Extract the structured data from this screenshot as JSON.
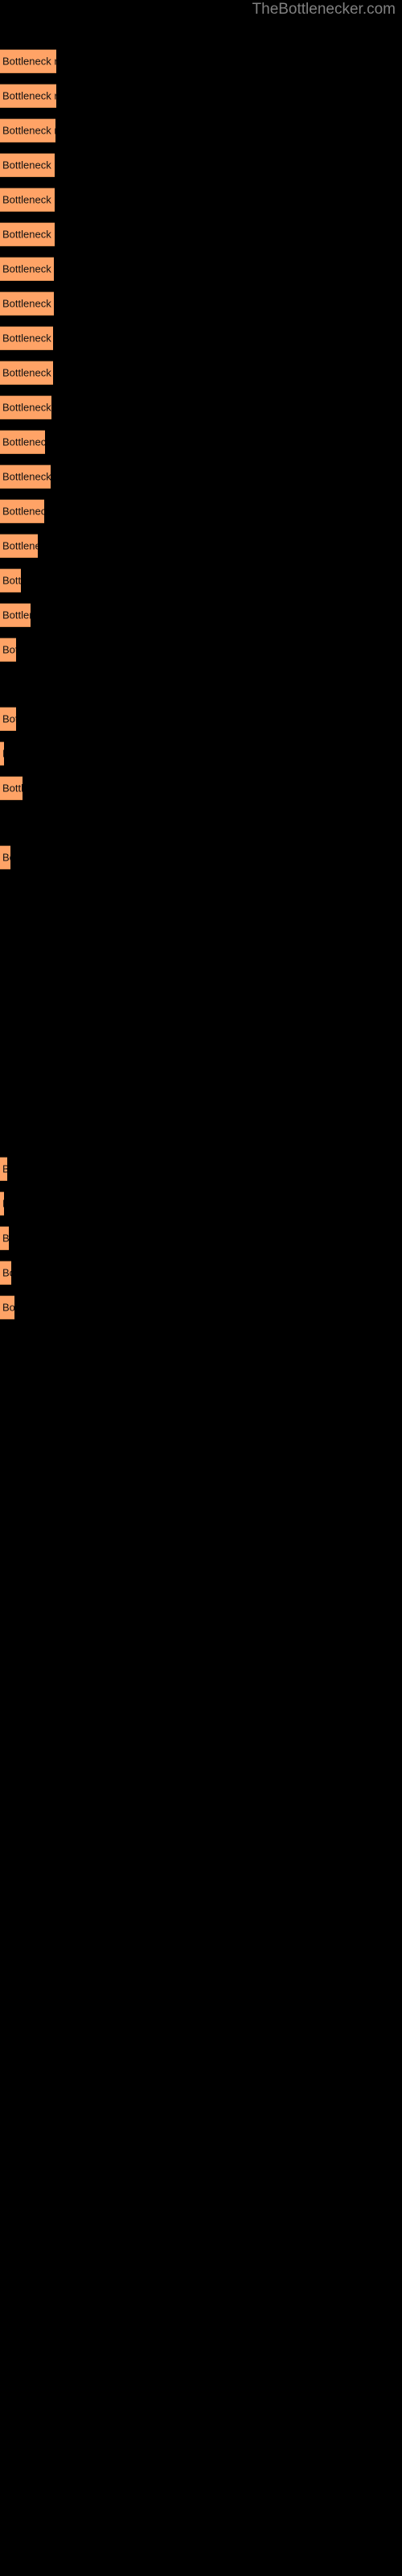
{
  "site": {
    "watermark": "TheBottlenecker.com"
  },
  "colors": {
    "background": "#000000",
    "bar_fill": "#ffa366",
    "bar_border_top": "#5a3b22",
    "bar_text": "#111111",
    "watermark_text": "#808080"
  },
  "chart_data": {
    "type": "bar",
    "orientation": "horizontal",
    "title": "",
    "subtitle": "",
    "xlabel": "",
    "ylabel": "",
    "grid": false,
    "legend": null,
    "axis_labels_visible": false,
    "bar_label_template": "Bottleneck result",
    "xlim": [
      0,
      500
    ],
    "categories": [
      "Bottleneck result",
      "Bottleneck result",
      "Bottleneck result",
      "Bottleneck result",
      "Bottleneck result",
      "Bottleneck result",
      "Bottleneck result",
      "Bottleneck result",
      "Bottleneck result",
      "Bottleneck result",
      "Bottleneck result",
      "Bottleneck result",
      "Bottleneck result",
      "Bottleneck result",
      "Bottleneck result",
      "Bottleneck result",
      "Bottleneck result",
      "Bottleneck result",
      "Bottleneck result",
      "Bottleneck result",
      "Bottleneck result",
      "Bottleneck result",
      "Bottleneck result",
      "Bottleneck result",
      "Bottleneck result",
      "Bottleneck result",
      "Bottleneck result",
      "Bottleneck result",
      "Bottleneck result",
      "Bottleneck result",
      "Bottleneck result"
    ],
    "values": [
      70,
      70,
      69,
      68,
      68,
      68,
      67,
      67,
      66,
      66,
      64,
      56,
      63,
      55,
      47,
      38,
      44,
      20,
      38,
      22,
      11,
      32,
      13,
      9,
      5,
      5,
      9,
      4,
      14,
      16,
      18
    ],
    "bars": [
      {
        "index": 1,
        "label": "Bottleneck result",
        "top": 61,
        "width": 70,
        "height": 30
      },
      {
        "index": 2,
        "label": "Bottleneck result",
        "top": 104,
        "width": 70,
        "height": 30
      },
      {
        "index": 3,
        "label": "Bottleneck result",
        "top": 147,
        "width": 69,
        "height": 30
      },
      {
        "index": 4,
        "label": "Bottleneck resu",
        "top": 190,
        "width": 68,
        "height": 30
      },
      {
        "index": 5,
        "label": "Bottleneck resu",
        "top": 233,
        "width": 68,
        "height": 30
      },
      {
        "index": 6,
        "label": "Bottleneck resu",
        "top": 276,
        "width": 68,
        "height": 30
      },
      {
        "index": 7,
        "label": "Bottleneck resu",
        "top": 319,
        "width": 67,
        "height": 30
      },
      {
        "index": 8,
        "label": "Bottleneck resu",
        "top": 362,
        "width": 67,
        "height": 30
      },
      {
        "index": 9,
        "label": "Bottleneck resu",
        "top": 405,
        "width": 66,
        "height": 30
      },
      {
        "index": 10,
        "label": "Bottleneck resu",
        "top": 448,
        "width": 66,
        "height": 30
      },
      {
        "index": 11,
        "label": "Bottleneck res",
        "top": 491,
        "width": 64,
        "height": 30
      },
      {
        "index": 12,
        "label": "Bottleneck re",
        "top": 534,
        "width": 56,
        "height": 30
      },
      {
        "index": 13,
        "label": "Bottleneck res",
        "top": 577,
        "width": 63,
        "height": 30
      },
      {
        "index": 14,
        "label": "Bottleneck re",
        "top": 620,
        "width": 55,
        "height": 30
      },
      {
        "index": 15,
        "label": "Bottleneck",
        "top": 663,
        "width": 47,
        "height": 30
      },
      {
        "index": 16,
        "label": "Bot",
        "top": 706,
        "width": 26,
        "height": 30
      },
      {
        "index": 17,
        "label": "Bottlen",
        "top": 749,
        "width": 38,
        "height": 30
      },
      {
        "index": 18,
        "label": "Bo",
        "top": 792,
        "width": 20,
        "height": 30
      },
      {
        "index": 19,
        "label": "Bo",
        "top": 878,
        "width": 20,
        "height": 30
      },
      {
        "index": 20,
        "label": "",
        "top": 921,
        "width": 5,
        "height": 30
      },
      {
        "index": 21,
        "label": "Bott",
        "top": 964,
        "width": 28,
        "height": 30
      },
      {
        "index": 22,
        "label": "B",
        "top": 1050,
        "width": 13,
        "height": 30
      },
      {
        "index": 23,
        "label": "B",
        "top": 1437,
        "width": 9,
        "height": 30
      },
      {
        "index": 24,
        "label": "",
        "top": 1480,
        "width": 5,
        "height": 30
      },
      {
        "index": 25,
        "label": "B",
        "top": 1523,
        "width": 11,
        "height": 30
      },
      {
        "index": 26,
        "label": "B",
        "top": 1566,
        "width": 14,
        "height": 30
      },
      {
        "index": 27,
        "label": "Bo",
        "top": 1609,
        "width": 18,
        "height": 30
      }
    ]
  }
}
